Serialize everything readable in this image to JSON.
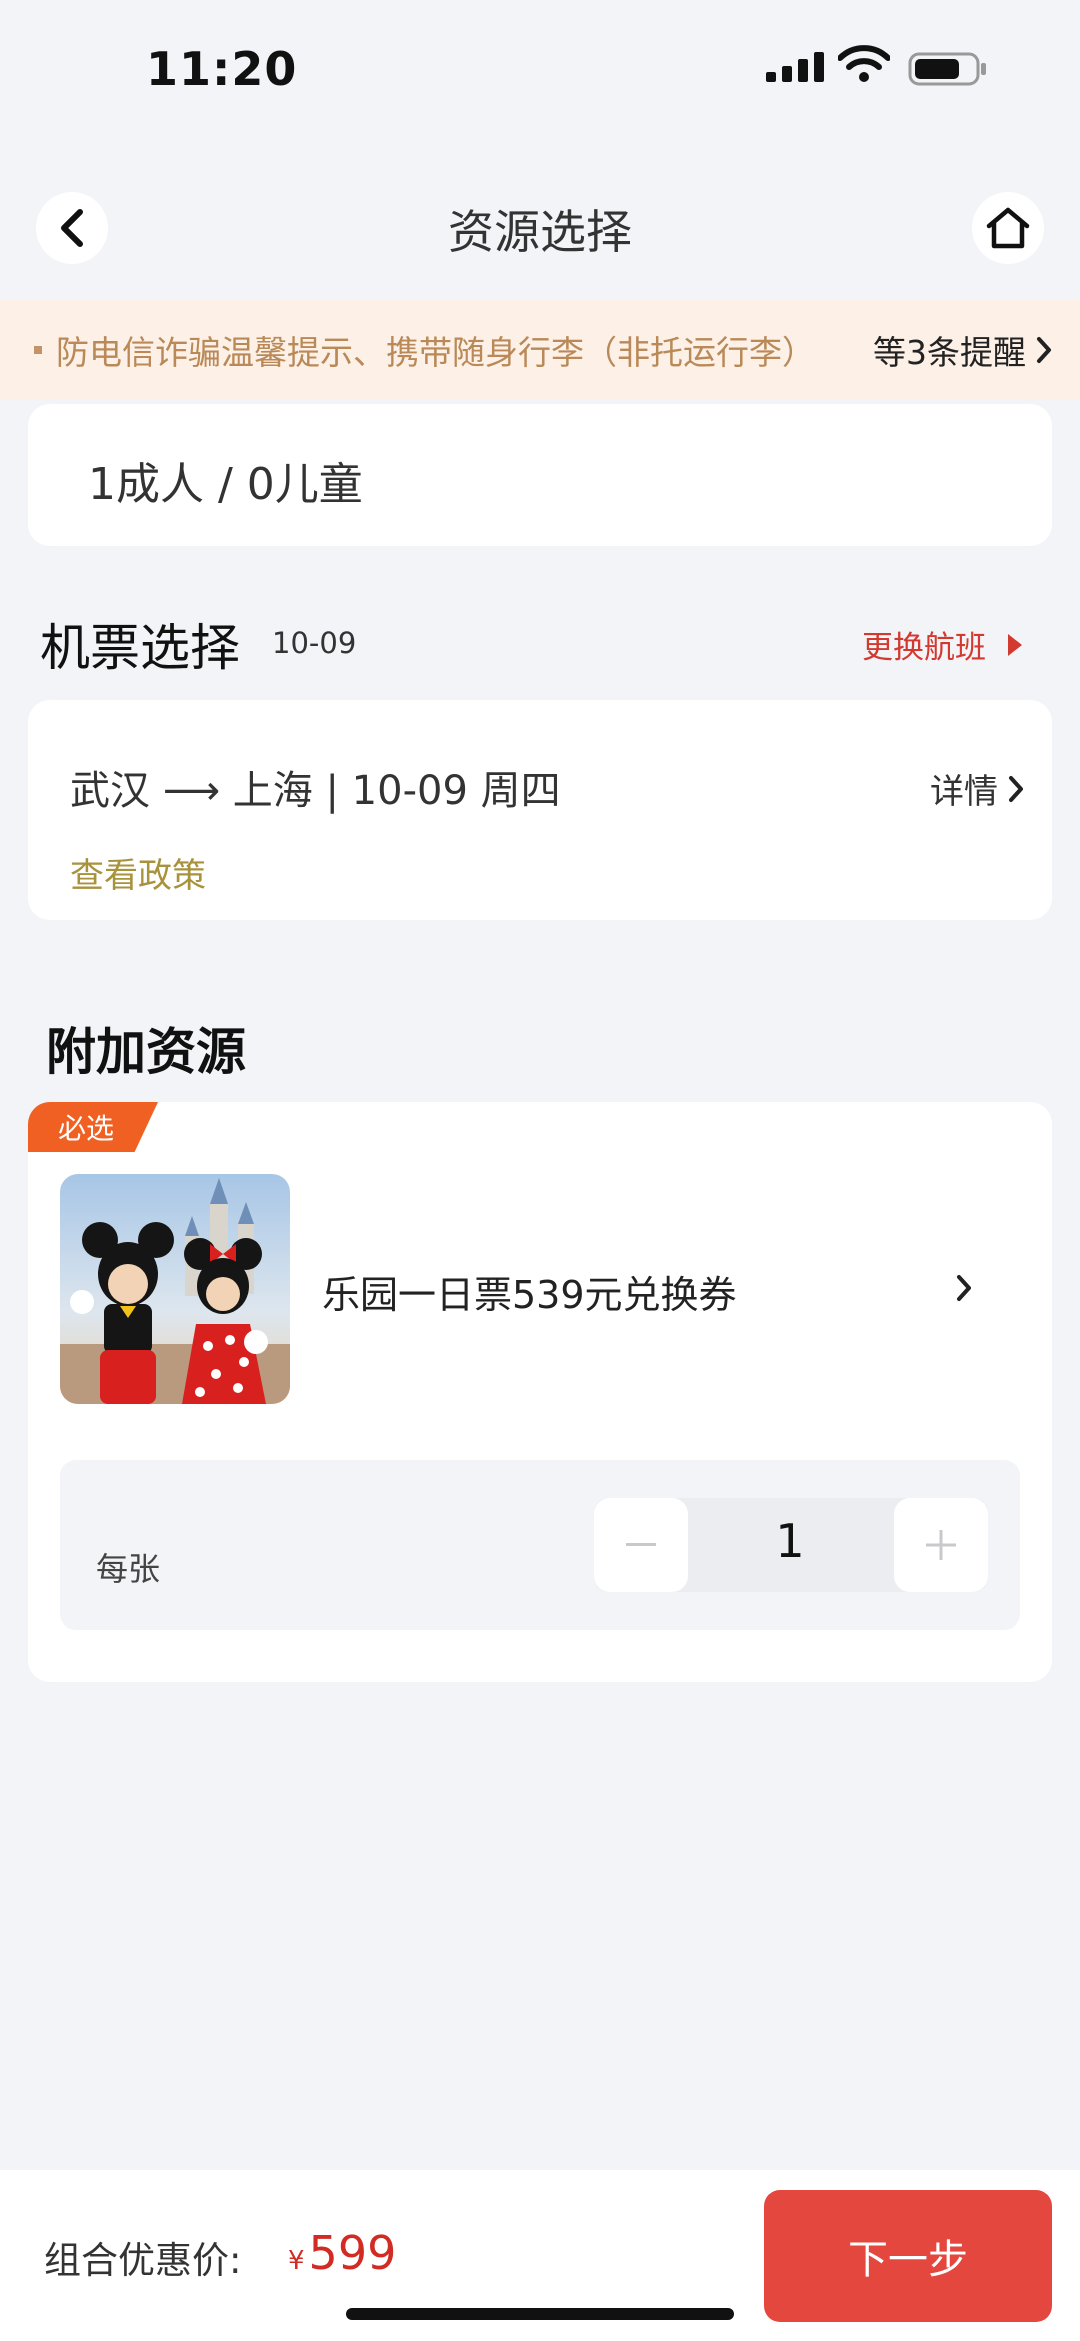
{
  "status_bar": {
    "time": "11:20"
  },
  "nav": {
    "title": "资源选择"
  },
  "notice": {
    "text": "防电信诈骗温馨提示、携带随身行李（非托运行李）",
    "more": "等3条提醒"
  },
  "passengers": {
    "summary": "1成人 / 0儿童"
  },
  "flight_section": {
    "title": "机票选择",
    "date": "10-09",
    "change_label": "更换航班",
    "route": "武汉 ⟶ 上海  |  10-09 周四",
    "detail_label": "详情",
    "policy_label": "查看政策"
  },
  "addon_section": {
    "title": "附加资源",
    "badge": "必选",
    "product_name": "乐园一日票539元兑换券",
    "unit_label": "每张",
    "quantity": "1"
  },
  "footer": {
    "combo_label": "组合优惠价:",
    "currency": "¥",
    "price": "599",
    "next_label": "下一步"
  },
  "colors": {
    "accent_red": "#d22b24",
    "badge_orange": "#f06022",
    "policy_gold": "#a9923c"
  }
}
